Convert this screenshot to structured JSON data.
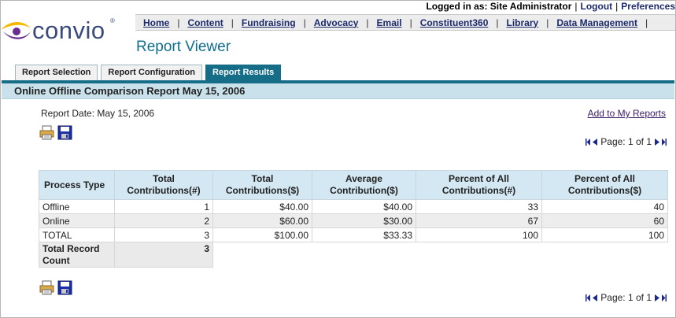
{
  "brand": {
    "logo_text": "convio",
    "reg_mark": "®"
  },
  "topbar": {
    "logged_in_text": "Logged in as: Site Administrator",
    "logout": "Logout",
    "preferences": "Preferences"
  },
  "nav": {
    "items": [
      "Home",
      "Content",
      "Fundraising",
      "Advocacy",
      "Email",
      "Constituent360",
      "Library",
      "Data Management"
    ]
  },
  "page": {
    "title": "Report Viewer"
  },
  "tabs": [
    "Report Selection",
    "Report Configuration",
    "Report Results"
  ],
  "active_tab": "Report Results",
  "report": {
    "header": "Online Offline Comparison Report May 15, 2006",
    "date_label": "Report Date: May 15, 2006",
    "add_link": "Add to My Reports",
    "pager_text": "Page: 1 of 1"
  },
  "icons": [
    "print-icon",
    "save-icon",
    "first-page-icon",
    "prev-page-icon",
    "next-page-icon",
    "last-page-icon"
  ],
  "colors": {
    "accent": "#156d87",
    "title": "#0f6f8c",
    "header_bg": "#c9e1ea",
    "link": "#1c2a6b"
  },
  "table": {
    "headers": [
      "Process Type",
      "Total Contributions(#)",
      "Total Contributions($)",
      "Average Contribution($)",
      "Percent of All Contributions(#)",
      "Percent of All Contributions($)"
    ],
    "rows": [
      [
        "Offline",
        "1",
        "$40.00",
        "$40.00",
        "33",
        "40"
      ],
      [
        "Online",
        "2",
        "$60.00",
        "$30.00",
        "67",
        "60"
      ],
      [
        "TOTAL",
        "3",
        "$100.00",
        "$33.33",
        "100",
        "100"
      ]
    ],
    "count_label": "Total Record Count",
    "count_value": "3"
  }
}
